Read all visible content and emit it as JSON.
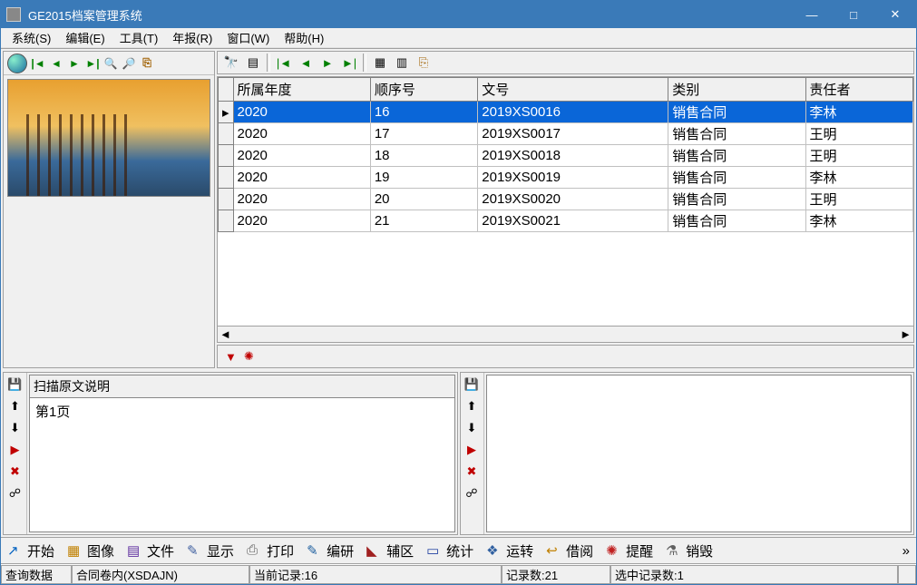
{
  "window": {
    "title": "GE2015档案管理系统"
  },
  "menu": {
    "items": [
      "系统(S)",
      "编辑(E)",
      "工具(T)",
      "年报(R)",
      "窗口(W)",
      "帮助(H)"
    ]
  },
  "grid": {
    "columns": [
      "所属年度",
      "顺序号",
      "文号",
      "类别",
      "责任者"
    ],
    "rows": [
      {
        "year": "2020",
        "seq": "16",
        "doc": "2019XS0016",
        "type": "销售合同",
        "owner": "李林",
        "selected": true
      },
      {
        "year": "2020",
        "seq": "17",
        "doc": "2019XS0017",
        "type": "销售合同",
        "owner": "王明"
      },
      {
        "year": "2020",
        "seq": "18",
        "doc": "2019XS0018",
        "type": "销售合同",
        "owner": "王明"
      },
      {
        "year": "2020",
        "seq": "19",
        "doc": "2019XS0019",
        "type": "销售合同",
        "owner": "李林"
      },
      {
        "year": "2020",
        "seq": "20",
        "doc": "2019XS0020",
        "type": "销售合同",
        "owner": "王明"
      },
      {
        "year": "2020",
        "seq": "21",
        "doc": "2019XS0021",
        "type": "销售合同",
        "owner": "李林"
      }
    ]
  },
  "scan": {
    "header": "扫描原文说明",
    "body": "第1页"
  },
  "toolbar": {
    "items": [
      {
        "icon": "↗",
        "label": "开始",
        "color": "#0060c0"
      },
      {
        "icon": "▦",
        "label": "图像",
        "color": "#c08000"
      },
      {
        "icon": "▤",
        "label": "文件",
        "color": "#6030a0"
      },
      {
        "icon": "✎",
        "label": "显示",
        "color": "#4060a0"
      },
      {
        "icon": "⎙",
        "label": "打印",
        "color": "#606060"
      },
      {
        "icon": "✎",
        "label": "编研",
        "color": "#2060a0"
      },
      {
        "icon": "◣",
        "label": "辅区",
        "color": "#a02020"
      },
      {
        "icon": "▭",
        "label": "统计",
        "color": "#2040a0"
      },
      {
        "icon": "❖",
        "label": "运转",
        "color": "#3060a0"
      },
      {
        "icon": "↩",
        "label": "借阅",
        "color": "#c08000"
      },
      {
        "icon": "✺",
        "label": "提醒",
        "color": "#c02020"
      },
      {
        "icon": "⚗",
        "label": "销毁",
        "color": "#606060"
      }
    ]
  },
  "status": {
    "s1": "查询数据",
    "s2": "合同卷内(XSDAJN)",
    "s3": "当前记录:16",
    "s4": "记录数:21",
    "s5": "选中记录数:1"
  }
}
